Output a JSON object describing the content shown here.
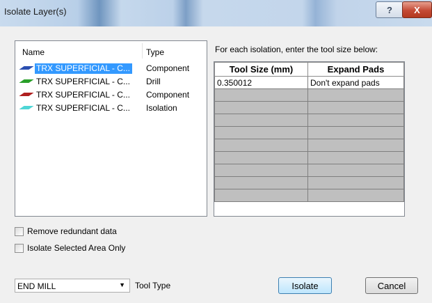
{
  "window": {
    "title": "Isolate Layer(s)",
    "help_label": "?",
    "close_label": "X"
  },
  "layers": {
    "headers": {
      "name": "Name",
      "type": "Type"
    },
    "rows": [
      {
        "name": "TRX SUPERFICIAL - C...",
        "type": "Component",
        "color": "#2b4fb0",
        "selected": true
      },
      {
        "name": "TRX SUPERFICIAL - C...",
        "type": "Drill",
        "color": "#2aa02a",
        "selected": false
      },
      {
        "name": "TRX SUPERFICIAL - C...",
        "type": "Component",
        "color": "#b02020",
        "selected": false
      },
      {
        "name": "TRX SUPERFICIAL - C...",
        "type": "Isolation",
        "color": "#4fd6d6",
        "selected": false
      }
    ]
  },
  "isolation": {
    "instruction": "For each isolation, enter the tool size below:",
    "columns": [
      "Tool Size (mm)",
      "Expand Pads"
    ],
    "rows": [
      [
        "0.350012",
        "Don't expand pads"
      ],
      [
        "",
        ""
      ],
      [
        "",
        ""
      ],
      [
        "",
        ""
      ],
      [
        "",
        ""
      ],
      [
        "",
        ""
      ],
      [
        "",
        ""
      ],
      [
        "",
        ""
      ],
      [
        "",
        ""
      ],
      [
        "",
        ""
      ]
    ]
  },
  "options": {
    "remove_redundant": {
      "label": "Remove redundant data",
      "checked": false
    },
    "selected_area_only": {
      "label": "Isolate Selected Area Only",
      "checked": false
    }
  },
  "tool_type": {
    "value": "END MILL",
    "label": "Tool Type"
  },
  "buttons": {
    "isolate": "Isolate",
    "cancel": "Cancel"
  }
}
